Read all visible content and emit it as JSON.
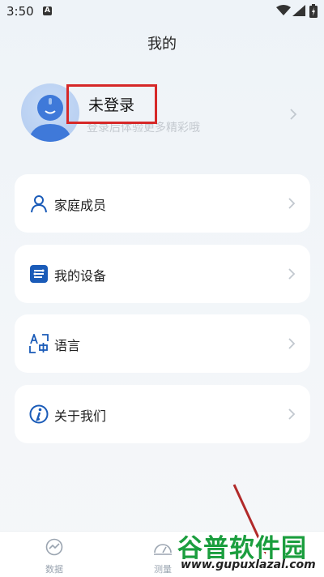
{
  "status_bar": {
    "time": "3:50",
    "badge": "A"
  },
  "header": {
    "title": "我的"
  },
  "profile": {
    "title": "未登录",
    "subtitle": "登录后体验更多精彩哦"
  },
  "menu": [
    {
      "label": "家庭成员",
      "icon": "person-icon"
    },
    {
      "label": "我的设备",
      "icon": "device-icon"
    },
    {
      "label": "语言",
      "icon": "language-icon"
    },
    {
      "label": "关于我们",
      "icon": "info-icon"
    }
  ],
  "bottom_nav": [
    {
      "label": "数据",
      "icon": "chart-icon"
    },
    {
      "label": "测量",
      "icon": "scale-icon"
    }
  ],
  "watermark": {
    "text": "谷普软件园",
    "url": "www.gupuxlazal.com"
  },
  "colors": {
    "accent": "#1a5bb8",
    "highlight_box": "#d62828",
    "watermark": "#1b9e3e"
  }
}
